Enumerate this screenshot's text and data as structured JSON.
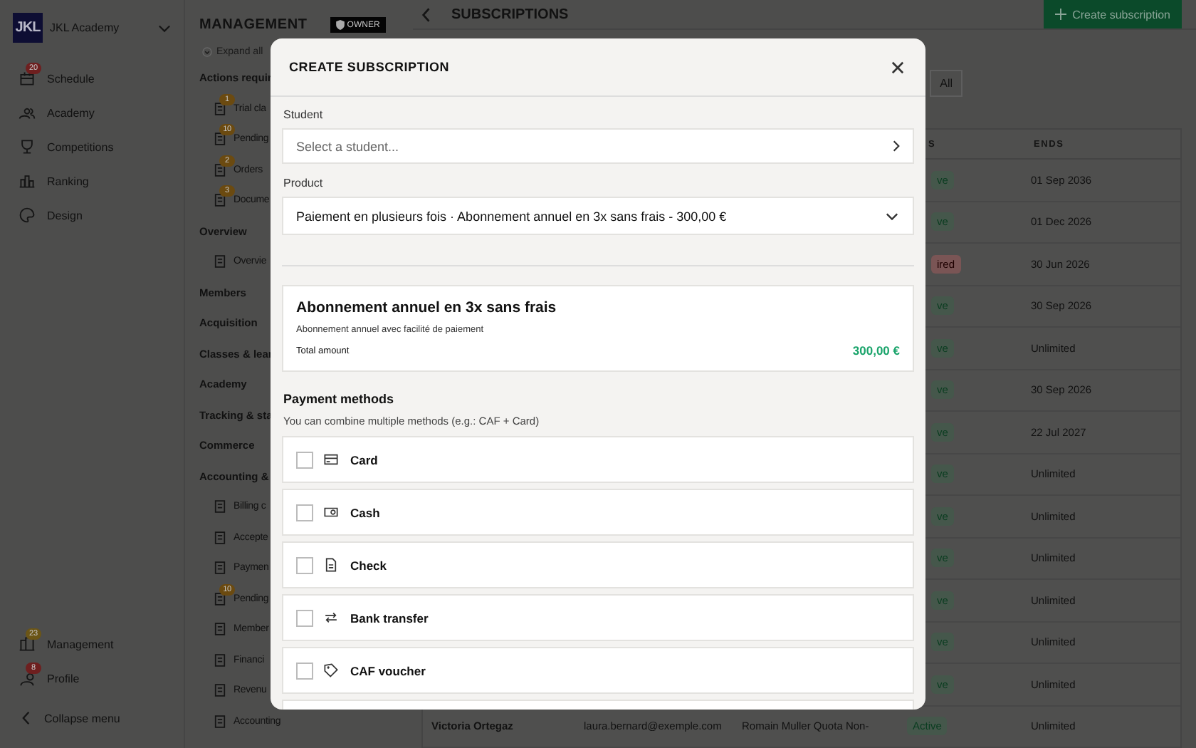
{
  "sidebar": {
    "logo": "JKL",
    "org_name": "JKL Academy",
    "items": [
      {
        "label": "Schedule",
        "badge": "20",
        "color": "#6e1f1f"
      },
      {
        "label": "Academy"
      },
      {
        "label": "Competitions"
      },
      {
        "label": "Ranking"
      },
      {
        "label": "Design"
      }
    ],
    "bottom_items": [
      {
        "label": "Management",
        "badge": "23",
        "color": "#6b5516"
      },
      {
        "label": "Profile",
        "badge": "8",
        "color": "#6e1f1f"
      }
    ],
    "collapse": "Collapse menu"
  },
  "management": {
    "title": "MANAGEMENT",
    "role": "OWNER",
    "expand": "Expand all",
    "sections": [
      {
        "label": "Actions requir",
        "children": [
          {
            "label": "Trial cla",
            "badge": "1"
          },
          {
            "label": "Pending",
            "badge": "10"
          },
          {
            "label": "Orders",
            "badge": "2"
          },
          {
            "label": "Docume",
            "badge": "3"
          }
        ]
      },
      {
        "label": "Overview",
        "children": [
          {
            "label": "Overvie"
          }
        ]
      },
      {
        "label": "Members"
      },
      {
        "label": "Acquisition"
      },
      {
        "label": "Classes & lear"
      },
      {
        "label": "Academy"
      },
      {
        "label": "Tracking & sta"
      },
      {
        "label": "Commerce"
      },
      {
        "label": "Accounting &",
        "children": [
          {
            "label": "Billing c"
          },
          {
            "label": "Accepte"
          },
          {
            "label": "Paymen"
          },
          {
            "label": "Pending",
            "badge": "10"
          },
          {
            "label": "Member"
          },
          {
            "label": "Financi"
          },
          {
            "label": "Revenu"
          },
          {
            "label": "Accounting"
          }
        ]
      }
    ]
  },
  "main": {
    "title": "SUBSCRIPTIONS",
    "create_button": "Create subscription",
    "filter": "All",
    "table": {
      "columns": [
        "S",
        "ENDS"
      ],
      "rows": [
        {
          "status": "ve",
          "kind": "active",
          "ends": "01 Sep 2036"
        },
        {
          "status": "ve",
          "kind": "active",
          "ends": "01 Dec 2026"
        },
        {
          "status": "ired",
          "kind": "expired",
          "ends": "30 Jun 2026"
        },
        {
          "status": "ve",
          "kind": "active",
          "ends": "30 Sep 2026"
        },
        {
          "status": "ve",
          "kind": "active",
          "ends": "Unlimited"
        },
        {
          "status": "ve",
          "kind": "active",
          "ends": "30 Sep 2026"
        },
        {
          "status": "ve",
          "kind": "active",
          "ends": "22 Jul 2027"
        },
        {
          "status": "ve",
          "kind": "active",
          "ends": "Unlimited"
        },
        {
          "status": "ve",
          "kind": "active",
          "ends": "Unlimited"
        },
        {
          "status": "ve",
          "kind": "active",
          "ends": "Unlimited"
        },
        {
          "status": "ve",
          "kind": "active",
          "ends": "Unlimited"
        },
        {
          "status": "ve",
          "kind": "active",
          "ends": "Unlimited"
        },
        {
          "status": "ve",
          "kind": "active",
          "ends": "Unlimited"
        },
        {
          "name": "Victoria Ortegaz",
          "email": "laura.bernard@exemple.com",
          "product": "Romain Muller Quota Non-",
          "status": "Active",
          "kind": "active",
          "ends": "Unlimited"
        }
      ]
    }
  },
  "modal": {
    "title": "CREATE SUBSCRIPTION",
    "student": {
      "label": "Student",
      "placeholder": "Select a student..."
    },
    "product": {
      "label": "Product",
      "value": "Paiement en plusieurs fois · Abonnement annuel en 3x sans frais - 300,00 €"
    },
    "summary": {
      "title": "Abonnement annuel en 3x sans frais",
      "description": "Abonnement annuel avec facilité de paiement",
      "total_label": "Total amount",
      "total": "300,00 €"
    },
    "payment": {
      "title": "Payment methods",
      "hint": "You can combine multiple methods (e.g.: CAF + Card)",
      "methods": [
        {
          "label": "Card",
          "checked": false
        },
        {
          "label": "Cash",
          "checked": false
        },
        {
          "label": "Check",
          "checked": false
        },
        {
          "label": "Bank transfer",
          "checked": false
        },
        {
          "label": "CAF voucher",
          "checked": false
        }
      ]
    }
  }
}
